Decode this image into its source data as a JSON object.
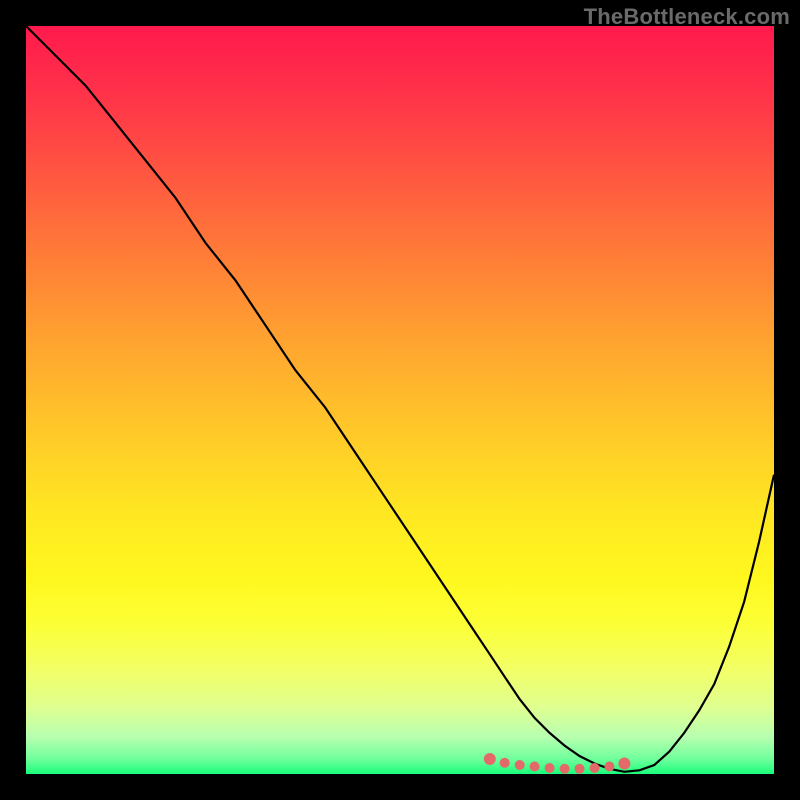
{
  "watermark": "TheBottleneck.com",
  "colors": {
    "frame": "#000000",
    "curve": "#000000",
    "dots": "#e46a6a"
  },
  "chart_data": {
    "type": "line",
    "title": "",
    "xlabel": "",
    "ylabel": "",
    "xlim": [
      0,
      100
    ],
    "ylim": [
      0,
      100
    ],
    "grid": false,
    "series": [
      {
        "name": "bottleneck-curve",
        "x": [
          0,
          4,
          8,
          12,
          16,
          20,
          24,
          28,
          32,
          36,
          40,
          44,
          48,
          52,
          56,
          60,
          62,
          64,
          66,
          68,
          70,
          72,
          74,
          76,
          78,
          80,
          82,
          84,
          86,
          88,
          90,
          92,
          94,
          96,
          98,
          100
        ],
        "values": [
          100,
          96,
          92,
          87,
          82,
          77,
          71,
          66,
          60,
          54,
          49,
          43,
          37,
          31,
          25,
          19,
          16,
          13,
          10,
          7.5,
          5.5,
          3.8,
          2.4,
          1.4,
          0.7,
          0.3,
          0.5,
          1.2,
          3.0,
          5.5,
          8.5,
          12,
          17,
          23,
          31,
          40
        ]
      }
    ],
    "highlight_dots": {
      "name": "optimal-range",
      "x": [
        62,
        64,
        66,
        68,
        70,
        72,
        74,
        76,
        78,
        80
      ],
      "values": [
        2.0,
        1.5,
        1.2,
        1.0,
        0.8,
        0.7,
        0.7,
        0.8,
        1.0,
        1.4
      ]
    }
  }
}
